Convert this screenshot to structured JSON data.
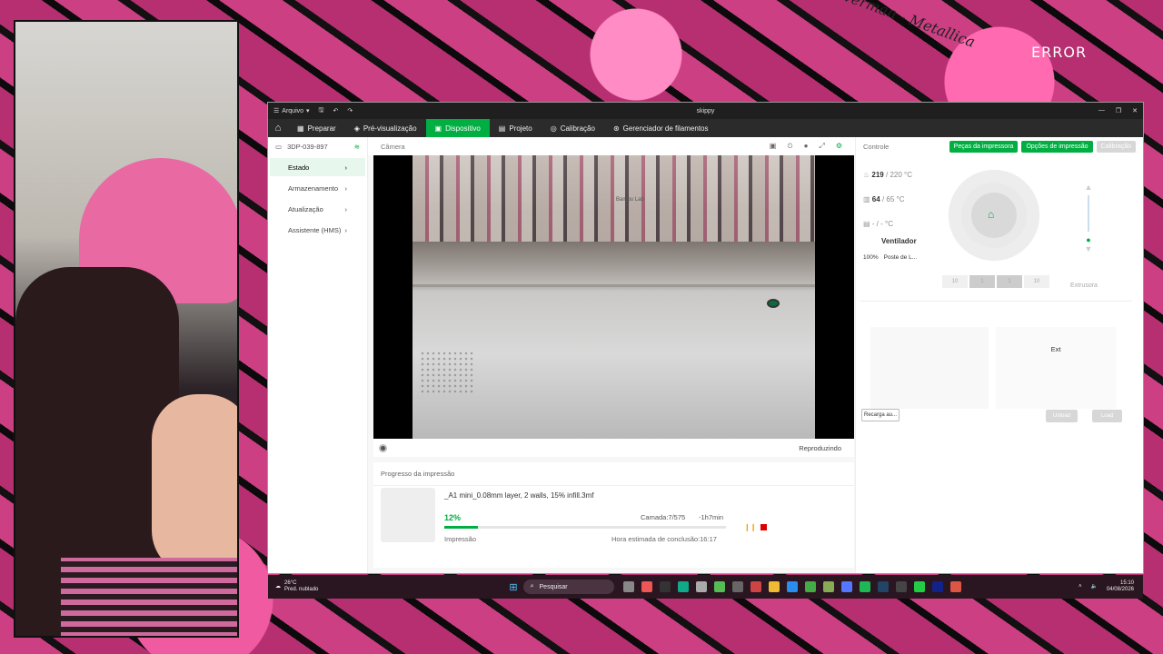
{
  "background": {
    "sticker_text": "Loverman - Metallica",
    "error_text": "ERROR"
  },
  "window": {
    "title": "skippy",
    "menu": "Arquivo",
    "controls": [
      "—",
      "❐",
      "✕"
    ]
  },
  "nav": {
    "tabs": [
      {
        "label": "Preparar",
        "icon": "slice-icon"
      },
      {
        "label": "Pré-visualização",
        "icon": "cube-icon"
      },
      {
        "label": "Dispositivo",
        "icon": "device-icon",
        "active": true
      },
      {
        "label": "Projeto",
        "icon": "project-icon"
      },
      {
        "label": "Calibração",
        "icon": "calibration-icon"
      },
      {
        "label": "Gerenciador de filamentos",
        "icon": "filament-icon"
      }
    ]
  },
  "sidebar": {
    "device": "3DP-039-897",
    "items": [
      {
        "label": "Estado",
        "active": true
      },
      {
        "label": "Armazenamento"
      },
      {
        "label": "Atualização"
      },
      {
        "label": "Assistente (HMS)"
      }
    ]
  },
  "camera": {
    "title": "Câmera",
    "status": "Reproduzindo",
    "overlay_text": "Bambu Lab"
  },
  "progress": {
    "header": "Progresso da impressão",
    "file": "_A1 mini_0.08mm layer, 2 walls, 15% infill.3mf",
    "percent": "12%",
    "percent_value": 12,
    "layer": "Camada:7/575",
    "remaining": "-1h7min",
    "state": "Impressão",
    "eta": "Hora estimada de conclusão:16:17"
  },
  "control": {
    "title": "Controle",
    "btn_parts": "Peças da impressora",
    "btn_options": "Opções de impressão",
    "btn_calib": "Calibração",
    "nozzle": "219",
    "nozzle_target": "/ 220 °C",
    "bed": "64",
    "bed_target": "/ 65 °C",
    "chamber": "- / -",
    "chamber_unit": "°C",
    "fan_title": "Ventilador",
    "fan_value": "100%",
    "fan_label": "Poste de L...",
    "z_steps": [
      "10",
      "1",
      "1",
      "10"
    ],
    "extruder": "Extrusora",
    "ext_label": "Ext",
    "recarga": "Recarga au...",
    "unload": "Unload",
    "load": "Load"
  },
  "taskbar": {
    "temp": "26°C",
    "weather": "Pred. nublado",
    "search": "Pesquisar",
    "time": "15:10",
    "date": "04/08/2026"
  },
  "colors": {
    "accent": "#00ae42",
    "stop": "#dd0000"
  }
}
